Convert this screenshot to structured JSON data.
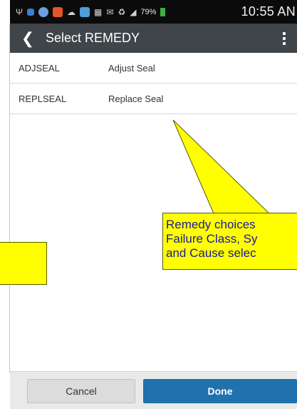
{
  "status_bar": {
    "battery_percent": "79%",
    "time": "10:55 AN"
  },
  "app_bar": {
    "back_icon": "chevron-left-icon",
    "title": "Select REMEDY",
    "overflow_icon": "overflow-menu-icon"
  },
  "remedies": [
    {
      "code": "ADJSEAL",
      "description": "Adjust Seal"
    },
    {
      "code": "REPLSEAL",
      "description": "Replace Seal"
    }
  ],
  "buttons": {
    "cancel": "Cancel",
    "done": "Done"
  },
  "annotation": {
    "line1": "Remedy choices",
    "line2": "Failure Class, Sy",
    "line3": "and Cause selec"
  },
  "colors": {
    "app_bar": "#3f4549",
    "done_button": "#1f72ac",
    "callout_fill": "#ffff00",
    "callout_text": "#1a1a9a"
  }
}
